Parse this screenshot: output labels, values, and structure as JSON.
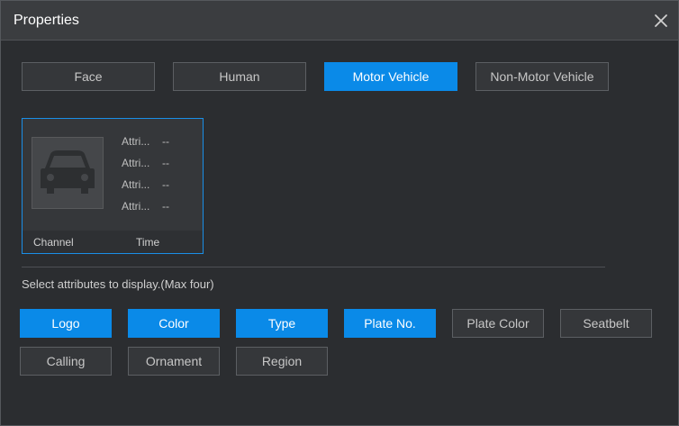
{
  "dialog": {
    "title": "Properties",
    "close_icon": "close-icon"
  },
  "tabs": [
    {
      "label": "Face",
      "active": false
    },
    {
      "label": "Human",
      "active": false
    },
    {
      "label": "Motor Vehicle",
      "active": true
    },
    {
      "label": "Non-Motor Vehicle",
      "active": false
    }
  ],
  "preview": {
    "icon": "car-icon",
    "attributes": [
      {
        "name": "Attri...",
        "value": "--"
      },
      {
        "name": "Attri...",
        "value": "--"
      },
      {
        "name": "Attri...",
        "value": "--"
      },
      {
        "name": "Attri...",
        "value": "--"
      }
    ],
    "footer": {
      "channel": "Channel",
      "time": "Time"
    }
  },
  "hint": "Select attributes to display.(Max four)",
  "attribute_options": [
    {
      "label": "Logo",
      "selected": true
    },
    {
      "label": "Color",
      "selected": true
    },
    {
      "label": "Type",
      "selected": true
    },
    {
      "label": "Plate No.",
      "selected": true
    },
    {
      "label": "Plate Color",
      "selected": false
    },
    {
      "label": "Seatbelt",
      "selected": false
    },
    {
      "label": "Calling",
      "selected": false
    },
    {
      "label": "Ornament",
      "selected": false
    },
    {
      "label": "Region",
      "selected": false
    }
  ],
  "colors": {
    "accent": "#0a8ae8",
    "background": "#2b2d30",
    "titlebar": "#3b3d40"
  }
}
